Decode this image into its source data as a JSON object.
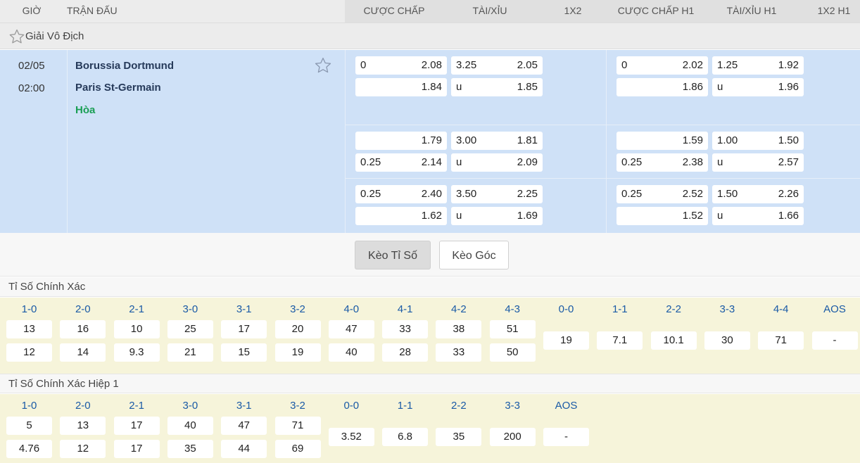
{
  "headers": {
    "time": "GIỜ",
    "match": "TRẬN ĐẤU",
    "handicap": "CƯỢC CHẤP",
    "over_under": "TÀI/XỈU",
    "one_x_two": "1X2",
    "handicap_h1": "CƯỢC CHẤP H1",
    "over_under_h1": "TÀI/XỈU H1",
    "one_x_two_h1": "1X2 H1"
  },
  "league": {
    "name": "Giải Vô Địch",
    "star_icon": "star-outline-icon"
  },
  "match": {
    "date": "02/05",
    "time": "02:00",
    "home": "Borussia Dortmund",
    "away": "Paris St-Germain",
    "result": "Hòa",
    "result_color": "#1a9e54",
    "star_icon": "star-outline-icon"
  },
  "odds_rows": [
    {
      "handicap": [
        [
          "0",
          "2.08"
        ],
        [
          "",
          "1.84"
        ]
      ],
      "over_under": [
        [
          "3.25",
          "2.05"
        ],
        [
          "u",
          "1.85"
        ]
      ],
      "handicap_h1": [
        [
          "0",
          "2.02"
        ],
        [
          "",
          "1.86"
        ]
      ],
      "over_under_h1": [
        [
          "1.25",
          "1.92"
        ],
        [
          "u",
          "1.96"
        ]
      ]
    },
    {
      "handicap": [
        [
          "",
          "1.79"
        ],
        [
          "0.25",
          "2.14"
        ]
      ],
      "over_under": [
        [
          "3.00",
          "1.81"
        ],
        [
          "u",
          "2.09"
        ]
      ],
      "handicap_h1": [
        [
          "",
          "1.59"
        ],
        [
          "0.25",
          "2.38"
        ]
      ],
      "over_under_h1": [
        [
          "1.00",
          "1.50"
        ],
        [
          "u",
          "2.57"
        ]
      ]
    },
    {
      "handicap": [
        [
          "0.25",
          "2.40"
        ],
        [
          "",
          "1.62"
        ]
      ],
      "over_under": [
        [
          "3.50",
          "2.25"
        ],
        [
          "u",
          "1.69"
        ]
      ],
      "handicap_h1": [
        [
          "0.25",
          "2.52"
        ],
        [
          "",
          "1.52"
        ]
      ],
      "over_under_h1": [
        [
          "1.50",
          "2.26"
        ],
        [
          "u",
          "1.66"
        ]
      ]
    }
  ],
  "tabs": [
    {
      "label": "Kèo Tỉ Số",
      "active": true
    },
    {
      "label": "Kèo Góc",
      "active": false
    }
  ],
  "correct_score": {
    "title": "Tỉ Số Chính Xác",
    "scores": [
      {
        "label": "1-0",
        "home": "13",
        "away": "12"
      },
      {
        "label": "2-0",
        "home": "16",
        "away": "14"
      },
      {
        "label": "2-1",
        "home": "10",
        "away": "9.3"
      },
      {
        "label": "3-0",
        "home": "25",
        "away": "21"
      },
      {
        "label": "3-1",
        "home": "17",
        "away": "15"
      },
      {
        "label": "3-2",
        "home": "20",
        "away": "19"
      },
      {
        "label": "4-0",
        "home": "47",
        "away": "40"
      },
      {
        "label": "4-1",
        "home": "33",
        "away": "28"
      },
      {
        "label": "4-2",
        "home": "38",
        "away": "33"
      },
      {
        "label": "4-3",
        "home": "51",
        "away": "50"
      },
      {
        "label": "0-0",
        "single": "19"
      },
      {
        "label": "1-1",
        "single": "7.1"
      },
      {
        "label": "2-2",
        "single": "10.1"
      },
      {
        "label": "3-3",
        "single": "30"
      },
      {
        "label": "4-4",
        "single": "71"
      },
      {
        "label": "AOS",
        "single": "-"
      }
    ]
  },
  "correct_score_h1": {
    "title": "Tỉ Số Chính Xác Hiệp 1",
    "scores": [
      {
        "label": "1-0",
        "home": "5",
        "away": "4.76"
      },
      {
        "label": "2-0",
        "home": "13",
        "away": "12"
      },
      {
        "label": "2-1",
        "home": "17",
        "away": "17"
      },
      {
        "label": "3-0",
        "home": "40",
        "away": "35"
      },
      {
        "label": "3-1",
        "home": "47",
        "away": "44"
      },
      {
        "label": "3-2",
        "home": "71",
        "away": "69"
      },
      {
        "label": "0-0",
        "single": "3.52"
      },
      {
        "label": "1-1",
        "single": "6.8"
      },
      {
        "label": "2-2",
        "single": "35"
      },
      {
        "label": "3-3",
        "single": "200"
      },
      {
        "label": "AOS",
        "single": "-"
      }
    ]
  }
}
